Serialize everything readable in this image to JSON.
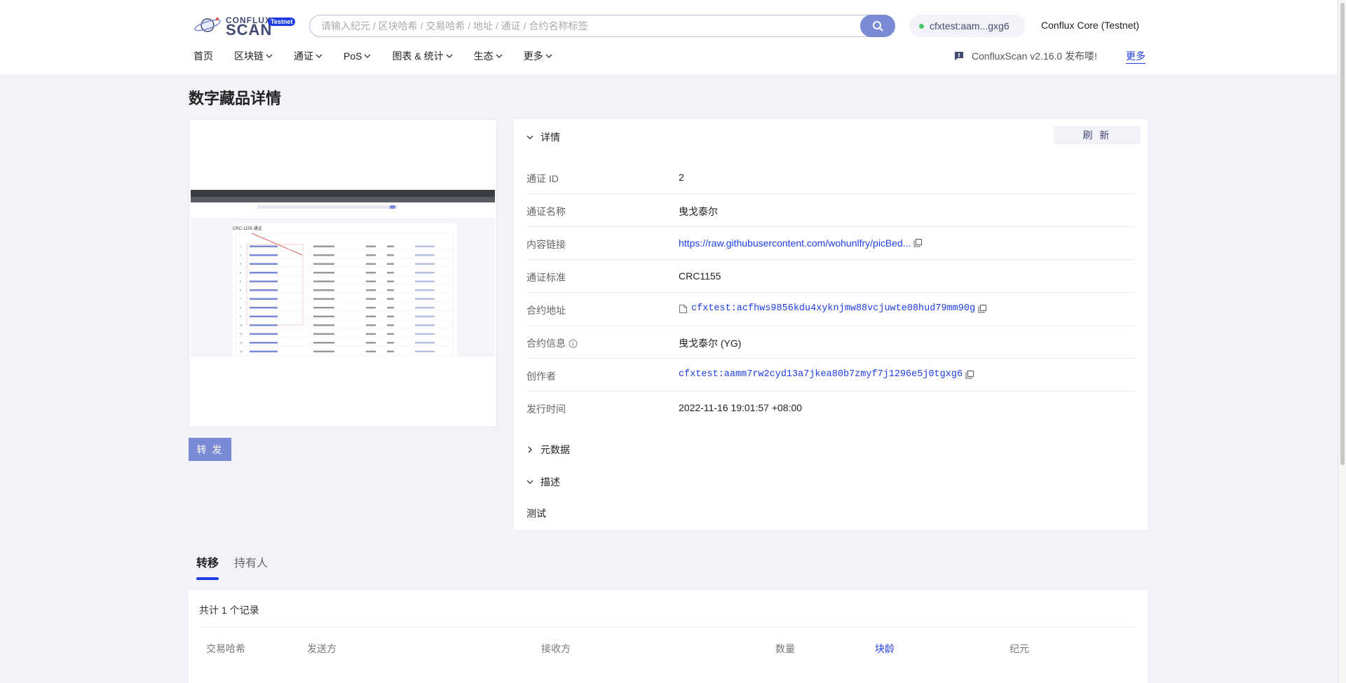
{
  "header": {
    "logo_top": "CONFLUX",
    "logo_bottom": "SCAN",
    "logo_badge": "Testnet",
    "search_placeholder": "请输入纪元 / 区块哈希 / 交易哈希 / 地址 / 通证 / 合约名称标签",
    "wallet_address": "cfxtest:aam...gxg6",
    "network": "Conflux Core (Testnet)",
    "nav": [
      "首页",
      "区块链",
      "通证",
      "PoS",
      "图表 & 统计",
      "生态",
      "更多"
    ],
    "notice": "ConfluxScan v2.16.0 发布喽!",
    "more_link": "更多"
  },
  "page": {
    "title": "数字藏品详情",
    "transfer_button": "转 发"
  },
  "details": {
    "section_title": "详情",
    "refresh_button": "刷 新",
    "rows": [
      {
        "label": "通证 ID",
        "value": "2"
      },
      {
        "label": "通证名称",
        "value": "曳戈泰尔"
      },
      {
        "label": "内容链接",
        "value": "https://raw.githubusercontent.com/wohunlfry/picBed..."
      },
      {
        "label": "通证标准",
        "value": "CRC1155"
      },
      {
        "label": "合约地址",
        "value": "cfxtest:acfhws9856kdu4xyknjmw88vcjuwte08hud79mm90g"
      },
      {
        "label": "合约信息",
        "value": "曳戈泰尔 (YG)"
      },
      {
        "label": "创作者",
        "value": "cfxtest:aamm7rw2cyd13a7jkea80b7zmyf7j1296e5j0tgxg6"
      },
      {
        "label": "发行时间",
        "value": "2022-11-16 19:01:57 +08:00"
      }
    ],
    "metadata_title": "元数据",
    "description_title": "描述",
    "description_text": "测试"
  },
  "tabs": [
    "转移",
    "持有人"
  ],
  "table": {
    "total": "共计 1 个记录",
    "headers": [
      "交易哈希",
      "发送方",
      "接收方",
      "数量",
      "块龄",
      "纪元"
    ]
  },
  "thumbnail": {
    "heading": "CRC-1155 通证",
    "rows": [
      "1",
      "2",
      "3",
      "4",
      "5",
      "6",
      "7",
      "8",
      "9",
      "10",
      "11",
      "12",
      "13"
    ]
  }
}
